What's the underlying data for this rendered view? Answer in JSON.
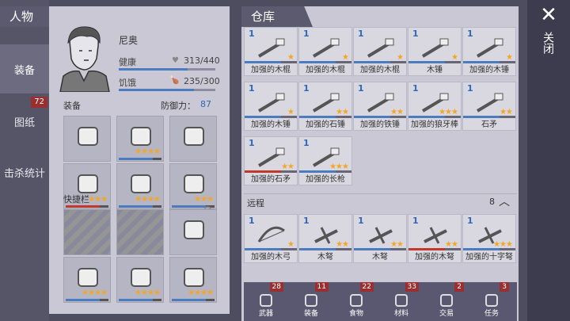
{
  "character_header": "人物",
  "storage_header": "仓库",
  "close": {
    "label": "关闭"
  },
  "side_tabs": [
    {
      "label": "装备",
      "active": true,
      "badge": ""
    },
    {
      "label": "图纸",
      "active": false,
      "badge": "72"
    },
    {
      "label": "击杀统计",
      "active": false,
      "badge": ""
    }
  ],
  "character": {
    "name": "尼奥",
    "health_label": "健康",
    "health_value": "313/440",
    "health_fraction": 0.71,
    "hunger_label": "饥饿",
    "hunger_value": "235/300",
    "hunger_fraction": 0.78
  },
  "equipment": {
    "label": "装备",
    "defense_label": "防御力：",
    "defense_value": "87",
    "slots": [
      {
        "icon": "helmet-icon",
        "stars": "",
        "bar_color": ""
      },
      {
        "icon": "armor-vest-icon",
        "stars": "★★★★",
        "bar_color": "#4b7cc0"
      },
      {
        "icon": "jacket-icon",
        "stars": "",
        "bar_color": ""
      },
      {
        "icon": "gloves-icon",
        "stars": "★★★",
        "bar_color": "#c0392b"
      },
      {
        "icon": "pants-icon",
        "stars": "★★★★",
        "bar_color": "#4b7cc0"
      },
      {
        "icon": "boots-icon",
        "stars": "★★★",
        "bar_color": "#4b7cc0"
      }
    ]
  },
  "quickbar": {
    "label": "快捷栏",
    "slots": [
      {
        "icon": "locked-slot",
        "stars": "",
        "bar_color": ""
      },
      {
        "icon": "locked-slot",
        "stars": "",
        "bar_color": ""
      },
      {
        "icon": "ammo-icon",
        "stars": "",
        "bar_color": ""
      },
      {
        "icon": "axe-icon",
        "stars": "★★★★",
        "bar_color": "#4b7cc0"
      },
      {
        "icon": "hammer-icon",
        "stars": "★★★★",
        "bar_color": "#4b7cc0"
      },
      {
        "icon": "bow-icon",
        "stars": "★★★★",
        "bar_color": "#4b7cc0"
      }
    ]
  },
  "melee_items": [
    {
      "count": "1",
      "name": "加强的木棍",
      "stars": "★",
      "bar_color": "#4b7cc0"
    },
    {
      "count": "1",
      "name": "加强的木棍",
      "stars": "★",
      "bar_color": "#4b7cc0"
    },
    {
      "count": "1",
      "name": "加强的木棍",
      "stars": "★",
      "bar_color": "#4b7cc0"
    },
    {
      "count": "1",
      "name": "木锤",
      "stars": "★",
      "bar_color": "#4b7cc0"
    },
    {
      "count": "1",
      "name": "加强的木锤",
      "stars": "★",
      "bar_color": "#4b7cc0"
    },
    {
      "count": "1",
      "name": "加强的木锤",
      "stars": "★",
      "bar_color": "#4b7cc0"
    },
    {
      "count": "1",
      "name": "加强的石锤",
      "stars": "★★",
      "bar_color": "#4b7cc0"
    },
    {
      "count": "1",
      "name": "加强的铁锤",
      "stars": "★★",
      "bar_color": "#4b7cc0"
    },
    {
      "count": "1",
      "name": "加强的狼牙棒",
      "stars": "★★★",
      "bar_color": "#4b7cc0"
    },
    {
      "count": "1",
      "name": "石矛",
      "stars": "★★",
      "bar_color": "#4b7cc0"
    },
    {
      "count": "1",
      "name": "加强的石矛",
      "stars": "★★",
      "bar_color": "#c0392b"
    },
    {
      "count": "1",
      "name": "加强的长枪",
      "stars": "★★★",
      "bar_color": "#4b7cc0"
    }
  ],
  "ranged_section": {
    "label": "远程",
    "count": "8"
  },
  "ranged_items": [
    {
      "count": "1",
      "name": "加强的木弓",
      "stars": "★",
      "bar_color": "#4b7cc0"
    },
    {
      "count": "1",
      "name": "木弩",
      "stars": "★★",
      "bar_color": "#4b7cc0"
    },
    {
      "count": "1",
      "name": "木弩",
      "stars": "★★",
      "bar_color": "#4b7cc0"
    },
    {
      "count": "1",
      "name": "加强的木弩",
      "stars": "★★",
      "bar_color": "#c0392b"
    },
    {
      "count": "1",
      "name": "加强的十字弩",
      "stars": "★★★",
      "bar_color": "#4b7cc0"
    }
  ],
  "categories": [
    {
      "label": "武器",
      "badge": "28",
      "icon": "weapon-axe-icon"
    },
    {
      "label": "装备",
      "badge": "11",
      "icon": "equipment-shirt-icon"
    },
    {
      "label": "食物",
      "badge": "22",
      "icon": "food-icon"
    },
    {
      "label": "材料",
      "badge": "33",
      "icon": "materials-icon"
    },
    {
      "label": "交易",
      "badge": "2",
      "icon": "trade-bag-icon"
    },
    {
      "label": "任务",
      "badge": "3",
      "icon": "quest-key-icon"
    }
  ]
}
